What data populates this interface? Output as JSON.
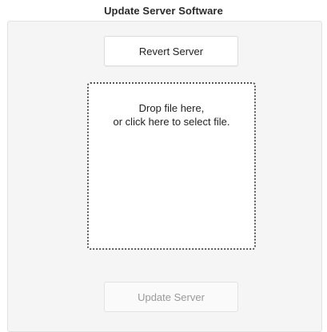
{
  "title": "Update Server Software",
  "buttons": {
    "revert_label": "Revert Server",
    "update_label": "Update Server"
  },
  "dropzone": {
    "line1": "Drop file here,",
    "line2": "or click here to select file."
  }
}
